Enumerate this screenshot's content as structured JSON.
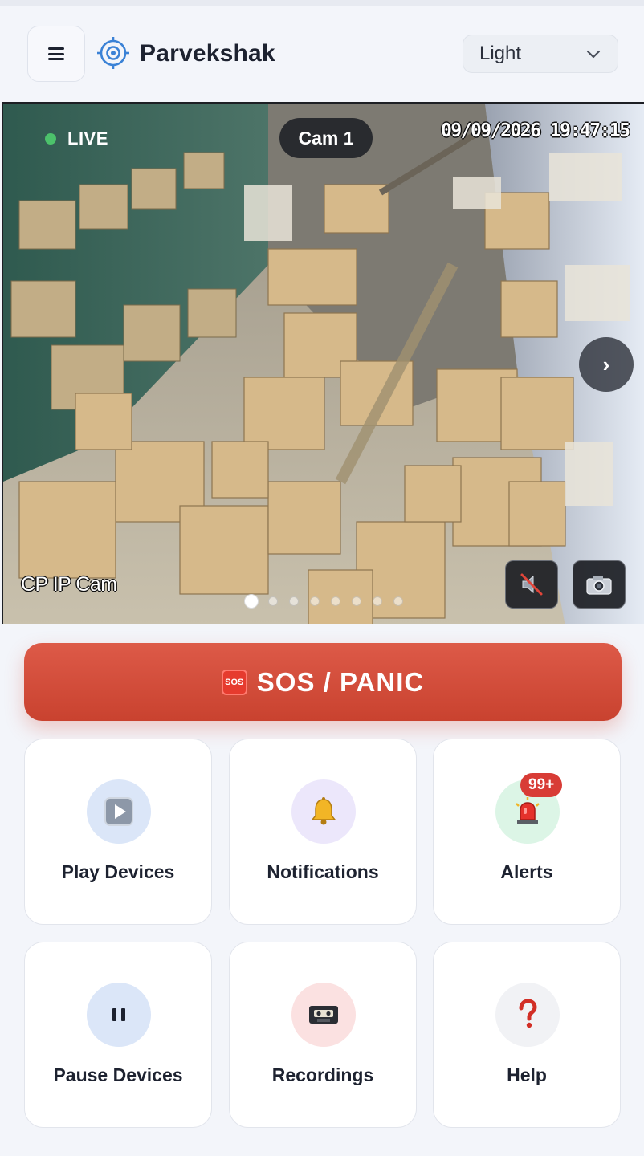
{
  "header": {
    "menu_icon": "hamburger-menu-icon",
    "logo_icon": "target-crosshair-icon",
    "app_name": "Parvekshak",
    "theme_select": {
      "selected": "Light"
    }
  },
  "camera": {
    "live_label": "LIVE",
    "cam_label": "Cam 1",
    "timestamp": "09/09/2026 19:47:15",
    "overlay_name": "CP IP Cam",
    "next_label": "›",
    "carousel": {
      "count": 8,
      "active_index": 0
    },
    "controls": [
      "speaker-muted-icon",
      "camera-snapshot-icon"
    ]
  },
  "sos": {
    "icon_text": "SOS",
    "label": "SOS / PANIC"
  },
  "tiles": [
    {
      "label": "Play Devices",
      "icon": "play-button-icon",
      "icon_bg": "#dbe6f8"
    },
    {
      "label": "Notifications",
      "icon": "bell-icon",
      "icon_bg": "#ece7fb"
    },
    {
      "label": "Alerts",
      "icon": "siren-icon",
      "icon_bg": "#dcf5e6",
      "badge": "99+"
    },
    {
      "label": "Pause Devices",
      "icon": "pause-icon",
      "icon_bg": "#dbe6f8"
    },
    {
      "label": "Recordings",
      "icon": "videocassette-icon",
      "icon_bg": "#fbe1e1"
    },
    {
      "label": "Help",
      "icon": "question-mark-icon",
      "icon_bg": "#f1f2f5"
    }
  ],
  "colors": {
    "accent": "#d34c3a",
    "live": "#4cc26b",
    "badge": "#d83c36",
    "logo": "#3b82d6"
  }
}
